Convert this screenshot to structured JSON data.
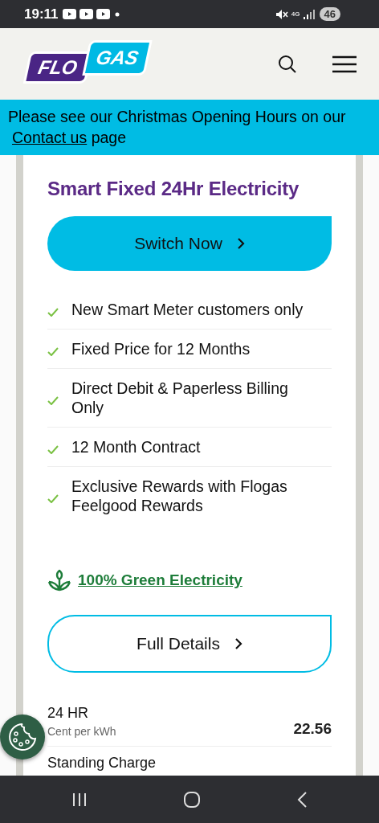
{
  "status_bar": {
    "time": "19:11",
    "network": "4G",
    "battery": "46"
  },
  "header": {
    "logo": [
      "FLO",
      "GAS"
    ]
  },
  "banner": {
    "text": "Please see our Christmas Opening Hours on our",
    "link": "Contact us",
    "text_after": "page"
  },
  "plan": {
    "title": "Smart Fixed 24Hr Electricity",
    "switch_button": "Switch Now",
    "features": [
      {
        "text": "New Smart Meter customers only"
      },
      {
        "text": "Fixed Price for 12 Months"
      },
      {
        "text": "Direct Debit & Paperless Billing Only"
      },
      {
        "text": "12 Month Contract"
      },
      {
        "text": "Exclusive Rewards with Flogas Feelgood Rewards"
      }
    ],
    "green_link": "100% Green Electricity",
    "details_button": "Full Details",
    "rates": [
      {
        "label": "24 HR",
        "unit": "Cent per kWh",
        "value": "22.56"
      },
      {
        "label": "Standing Charge"
      }
    ]
  }
}
